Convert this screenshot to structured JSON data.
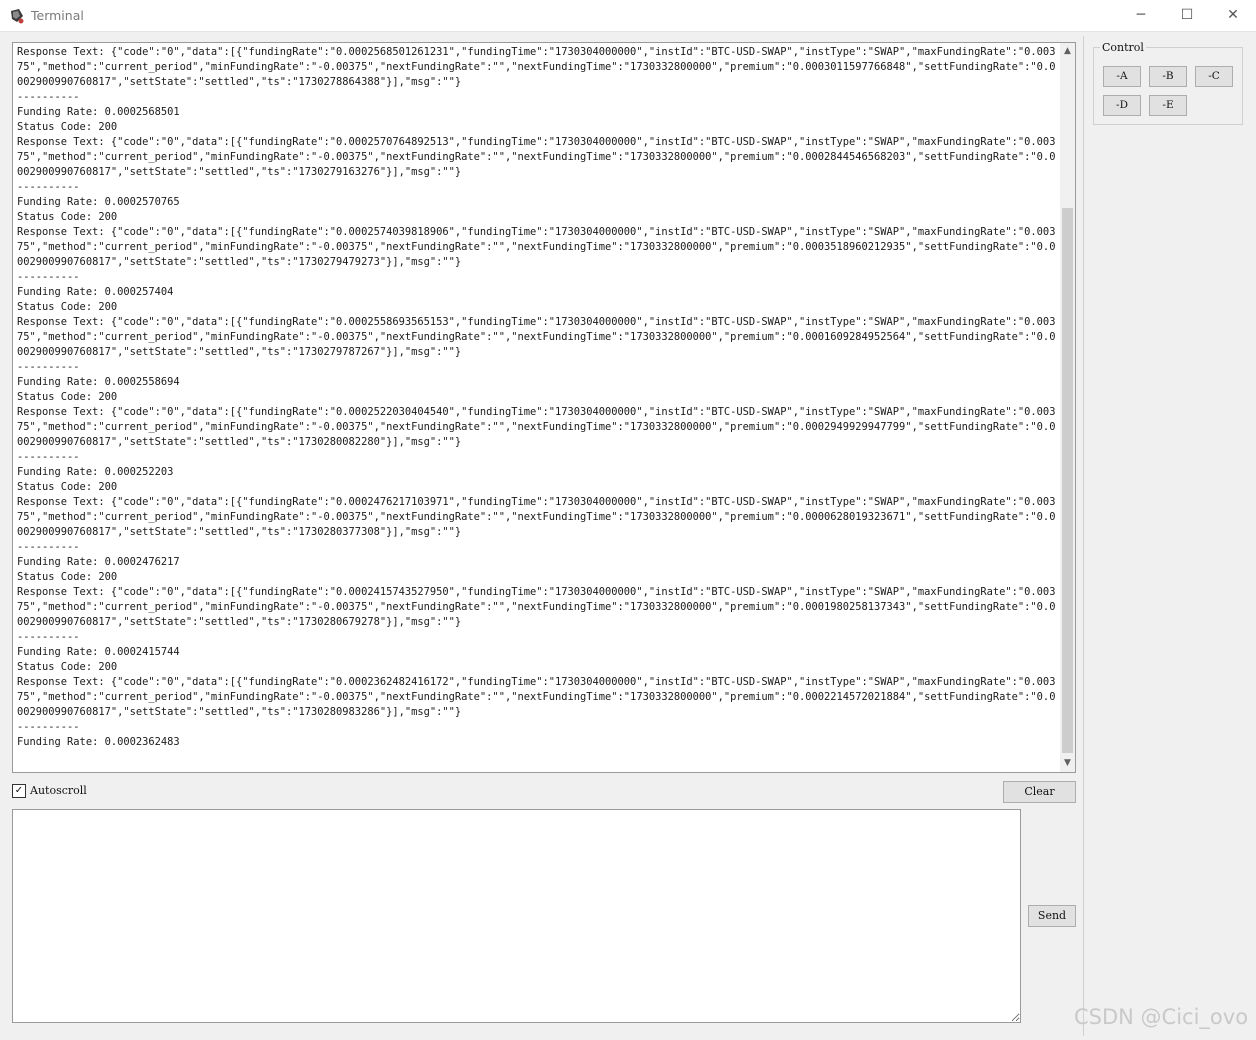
{
  "window": {
    "title": "Terminal",
    "minimize_glyph": "─",
    "maximize_glyph": "☐",
    "close_glyph": "✕"
  },
  "console": {
    "text": "Status Code: 200\nResponse Text: {\"code\":\"0\",\"data\":[{\"fundingRate\":\"0.0002568501261231\",\"fundingTime\":\"1730304000000\",\"instId\":\"BTC-USD-SWAP\",\"instType\":\"SWAP\",\"maxFundingRate\":\"0.00375\",\"method\":\"current_period\",\"minFundingRate\":\"-0.00375\",\"nextFundingRate\":\"\",\"nextFundingTime\":\"1730332800000\",\"premium\":\"0.0003011597766848\",\"settFundingRate\":\"0.0002900990760817\",\"settState\":\"settled\",\"ts\":\"1730278864388\"}],\"msg\":\"\"}\n----------\nFunding Rate: 0.0002568501\nStatus Code: 200\nResponse Text: {\"code\":\"0\",\"data\":[{\"fundingRate\":\"0.0002570764892513\",\"fundingTime\":\"1730304000000\",\"instId\":\"BTC-USD-SWAP\",\"instType\":\"SWAP\",\"maxFundingRate\":\"0.00375\",\"method\":\"current_period\",\"minFundingRate\":\"-0.00375\",\"nextFundingRate\":\"\",\"nextFundingTime\":\"1730332800000\",\"premium\":\"0.0002844546568203\",\"settFundingRate\":\"0.0002900990760817\",\"settState\":\"settled\",\"ts\":\"1730279163276\"}],\"msg\":\"\"}\n----------\nFunding Rate: 0.0002570765\nStatus Code: 200\nResponse Text: {\"code\":\"0\",\"data\":[{\"fundingRate\":\"0.0002574039818906\",\"fundingTime\":\"1730304000000\",\"instId\":\"BTC-USD-SWAP\",\"instType\":\"SWAP\",\"maxFundingRate\":\"0.00375\",\"method\":\"current_period\",\"minFundingRate\":\"-0.00375\",\"nextFundingRate\":\"\",\"nextFundingTime\":\"1730332800000\",\"premium\":\"0.0003518960212935\",\"settFundingRate\":\"0.0002900990760817\",\"settState\":\"settled\",\"ts\":\"1730279479273\"}],\"msg\":\"\"}\n----------\nFunding Rate: 0.000257404\nStatus Code: 200\nResponse Text: {\"code\":\"0\",\"data\":[{\"fundingRate\":\"0.0002558693565153\",\"fundingTime\":\"1730304000000\",\"instId\":\"BTC-USD-SWAP\",\"instType\":\"SWAP\",\"maxFundingRate\":\"0.00375\",\"method\":\"current_period\",\"minFundingRate\":\"-0.00375\",\"nextFundingRate\":\"\",\"nextFundingTime\":\"1730332800000\",\"premium\":\"0.0001609284952564\",\"settFundingRate\":\"0.0002900990760817\",\"settState\":\"settled\",\"ts\":\"1730279787267\"}],\"msg\":\"\"}\n----------\nFunding Rate: 0.0002558694\nStatus Code: 200\nResponse Text: {\"code\":\"0\",\"data\":[{\"fundingRate\":\"0.0002522030404540\",\"fundingTime\":\"1730304000000\",\"instId\":\"BTC-USD-SWAP\",\"instType\":\"SWAP\",\"maxFundingRate\":\"0.00375\",\"method\":\"current_period\",\"minFundingRate\":\"-0.00375\",\"nextFundingRate\":\"\",\"nextFundingTime\":\"1730332800000\",\"premium\":\"0.0002949929947799\",\"settFundingRate\":\"0.0002900990760817\",\"settState\":\"settled\",\"ts\":\"1730280082280\"}],\"msg\":\"\"}\n----------\nFunding Rate: 0.000252203\nStatus Code: 200\nResponse Text: {\"code\":\"0\",\"data\":[{\"fundingRate\":\"0.0002476217103971\",\"fundingTime\":\"1730304000000\",\"instId\":\"BTC-USD-SWAP\",\"instType\":\"SWAP\",\"maxFundingRate\":\"0.00375\",\"method\":\"current_period\",\"minFundingRate\":\"-0.00375\",\"nextFundingRate\":\"\",\"nextFundingTime\":\"1730332800000\",\"premium\":\"0.0000628019323671\",\"settFundingRate\":\"0.0002900990760817\",\"settState\":\"settled\",\"ts\":\"1730280377308\"}],\"msg\":\"\"}\n----------\nFunding Rate: 0.0002476217\nStatus Code: 200\nResponse Text: {\"code\":\"0\",\"data\":[{\"fundingRate\":\"0.0002415743527950\",\"fundingTime\":\"1730304000000\",\"instId\":\"BTC-USD-SWAP\",\"instType\":\"SWAP\",\"maxFundingRate\":\"0.00375\",\"method\":\"current_period\",\"minFundingRate\":\"-0.00375\",\"nextFundingRate\":\"\",\"nextFundingTime\":\"1730332800000\",\"premium\":\"0.0001980258137343\",\"settFundingRate\":\"0.0002900990760817\",\"settState\":\"settled\",\"ts\":\"1730280679278\"}],\"msg\":\"\"}\n----------\nFunding Rate: 0.0002415744\nStatus Code: 200\nResponse Text: {\"code\":\"0\",\"data\":[{\"fundingRate\":\"0.0002362482416172\",\"fundingTime\":\"1730304000000\",\"instId\":\"BTC-USD-SWAP\",\"instType\":\"SWAP\",\"maxFundingRate\":\"0.00375\",\"method\":\"current_period\",\"minFundingRate\":\"-0.00375\",\"nextFundingRate\":\"\",\"nextFundingTime\":\"1730332800000\",\"premium\":\"0.0002214572021884\",\"settFundingRate\":\"0.0002900990760817\",\"settState\":\"settled\",\"ts\":\"1730280983286\"}],\"msg\":\"\"}\n----------\nFunding Rate: 0.0002362483",
    "scroll_up_glyph": "▲",
    "scroll_down_glyph": "▼"
  },
  "autoscroll": {
    "label": "Autoscroll",
    "checked_glyph": "✓"
  },
  "buttons": {
    "clear": "Clear",
    "send": "Send"
  },
  "input": {
    "value": ""
  },
  "control": {
    "title": "Control",
    "buttons": [
      "-A",
      "-B",
      "-C",
      "-D",
      "-E"
    ]
  },
  "watermark": "CSDN @Cici_ovo"
}
